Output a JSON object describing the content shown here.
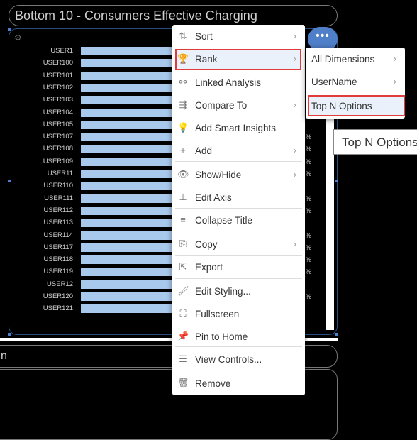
{
  "tile": {
    "title": "Bottom 10 - Consumers Effective Charging",
    "gear_icon": "gear-icon",
    "more_icon": "more-horizontal-icon"
  },
  "chart_data": {
    "type": "bar",
    "orientation": "horizontal",
    "categories": [
      "USER1",
      "USER100",
      "USER101",
      "USER102",
      "USER103",
      "USER104",
      "USER105",
      "USER107",
      "USER108",
      "USER109",
      "USER11",
      "USER110",
      "USER111",
      "USER112",
      "USER113",
      "USER114",
      "USER117",
      "USER118",
      "USER119",
      "USER12",
      "USER120",
      "USER121"
    ],
    "bar_color": "#a8c8ec",
    "pct_fragments": [
      "%",
      "%",
      "%",
      "%",
      "%",
      "%",
      "%",
      "%",
      "%",
      "%",
      "%"
    ]
  },
  "tile2": {
    "title_fragment": "n"
  },
  "menu": {
    "items": [
      {
        "icon": "sort-icon",
        "glyph": "⇅",
        "label": "Sort",
        "submenu": true
      },
      {
        "icon": "trophy-icon",
        "glyph": "🏆",
        "label": "Rank",
        "submenu": true
      },
      {
        "icon": "linked-analysis-icon",
        "glyph": "⚯",
        "label": "Linked Analysis",
        "submenu": false
      },
      {
        "icon": "compare-icon",
        "glyph": "⇶",
        "label": "Compare To",
        "submenu": true
      },
      {
        "icon": "lightbulb-icon",
        "glyph": "💡",
        "label": "Add Smart Insights",
        "submenu": false
      },
      {
        "icon": "plus-icon",
        "glyph": "+",
        "label": "Add",
        "submenu": true
      },
      {
        "icon": "eye-icon",
        "glyph": "👁",
        "label": "Show/Hide",
        "submenu": true
      },
      {
        "icon": "edit-axis-icon",
        "glyph": "⊥",
        "label": "Edit Axis",
        "submenu": false
      },
      {
        "icon": "collapse-title-icon",
        "glyph": "≡",
        "label": "Collapse Title",
        "submenu": false
      },
      {
        "icon": "copy-icon",
        "glyph": "⎘",
        "label": "Copy",
        "submenu": true
      },
      {
        "icon": "export-icon",
        "glyph": "⇱",
        "label": "Export",
        "submenu": false
      },
      {
        "icon": "paint-bucket-icon",
        "glyph": "🖌",
        "label": "Edit Styling...",
        "submenu": false
      },
      {
        "icon": "fullscreen-icon",
        "glyph": "⛶",
        "label": "Fullscreen",
        "submenu": false
      },
      {
        "icon": "pin-icon",
        "glyph": "📌",
        "label": "Pin to Home",
        "submenu": false
      },
      {
        "icon": "sliders-icon",
        "glyph": "☰",
        "label": "View Controls...",
        "submenu": false
      },
      {
        "icon": "trash-icon",
        "glyph": "🗑",
        "label": "Remove",
        "submenu": false
      }
    ]
  },
  "submenu": {
    "items": [
      {
        "label": "All Dimensions",
        "submenu": true
      },
      {
        "label": "UserName",
        "submenu": true
      },
      {
        "label": "Top N Options",
        "submenu": false
      }
    ]
  },
  "tooltip": {
    "text": "Top N Options"
  },
  "colors": {
    "highlight_border": "#e03c3c",
    "more_button": "#4f7fc8"
  }
}
